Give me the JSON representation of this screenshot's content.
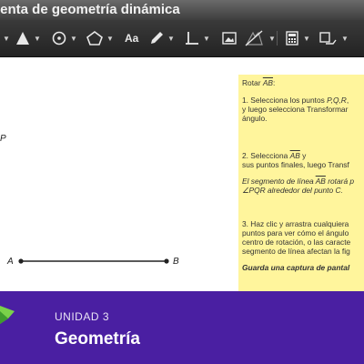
{
  "window": {
    "title": "ienta de geometría dinámica"
  },
  "toolbar": {
    "tools": [
      {
        "name": "point-tool",
        "icon": "filled-triangle-icon"
      },
      {
        "name": "circle-tool",
        "icon": "circle-dot-icon"
      },
      {
        "name": "polygon-tool",
        "icon": "pentagon-icon"
      },
      {
        "name": "text-tool",
        "icon": "text-icon",
        "label": "Aa"
      },
      {
        "name": "pencil-tool",
        "icon": "pencil-icon"
      },
      {
        "name": "measure-tool",
        "icon": "perpendicular-icon"
      },
      {
        "name": "image-tool",
        "icon": "image-icon"
      },
      {
        "name": "hide-tool",
        "icon": "hide-icon"
      },
      {
        "name": "calculator-tool",
        "icon": "calculator-icon"
      },
      {
        "name": "transform-tool",
        "icon": "transform-icon"
      }
    ]
  },
  "canvas": {
    "point_p_label": "P",
    "point_a_label": "A",
    "point_b_label": "B"
  },
  "note": {
    "line1_prefix": "Rotar ",
    "line1_seg": "AB",
    "line1_suffix": ":",
    "step1_line1_prefix": "1. Selecciona los puntos ",
    "step1_line1_pts": "P,Q,R",
    "step1_line1_suffix": ",",
    "step1_line2": "y luego selecciona Transformar",
    "step1_line3": "ángulo.",
    "step2_line1_prefix": "2. Selecciona ",
    "step2_line1_seg": "AB",
    "step2_line1_suffix": " y",
    "step2_line2": "sus puntos finales, luego Transf",
    "step2_line3_prefix": "El segmento de línea ",
    "step2_line3_seg": "AB",
    "step2_line3_suffix": " rotará p",
    "step2_line4": "∠PQR alrededor del punto C.",
    "step3_line1": "3. Haz clic y arrastra cualquiera",
    "step3_line2": "puntos para ver cómo el ángulo",
    "step3_line3": "centro de rotación, o las caracte",
    "step3_line4": "segmento de línea afectan la fig",
    "step3_line5": "Guarda una captura de pantal"
  },
  "footer": {
    "unit": "UNIDAD 3",
    "title": "Geometría",
    "color": "#4a1fa2"
  }
}
